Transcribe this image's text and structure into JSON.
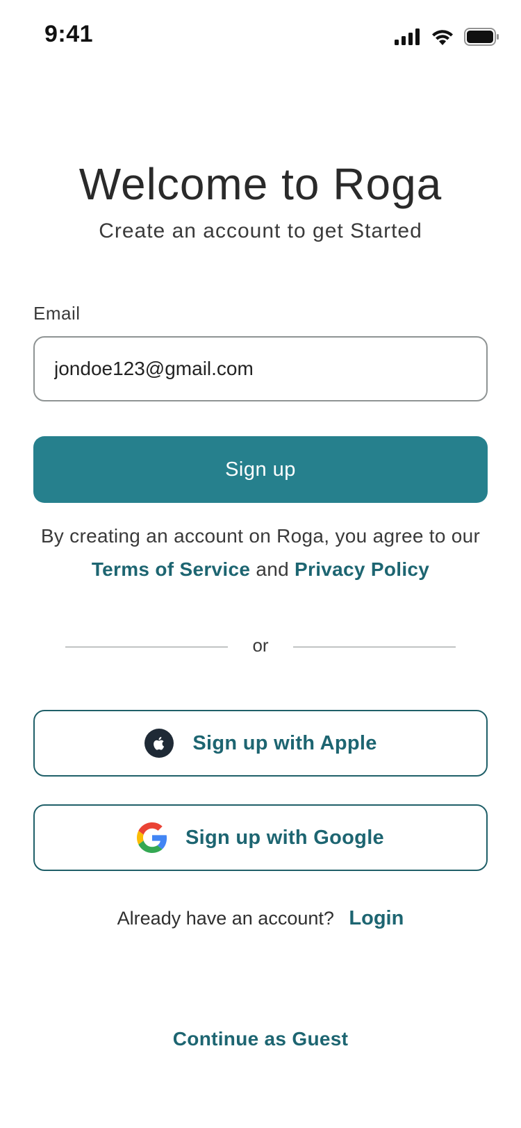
{
  "status_bar": {
    "time": "9:41"
  },
  "header": {
    "title": "Welcome to Roga",
    "subtitle": "Create an account to get Started"
  },
  "form": {
    "email_label": "Email",
    "email_value": "jondoe123@gmail.com",
    "signup_label": "Sign up"
  },
  "terms": {
    "prefix": "By creating an account on Roga, you agree to our",
    "terms_link": "Terms of Service",
    "conjunction": "and",
    "privacy_link": "Privacy Policy"
  },
  "divider": {
    "text": "or"
  },
  "social": {
    "apple_label": "Sign up with Apple",
    "google_label": "Sign up with Google"
  },
  "login": {
    "prompt": "Already have an account?",
    "link": "Login"
  },
  "guest": {
    "link": "Continue as Guest"
  },
  "colors": {
    "primary": "#26808d",
    "link": "#1d6571"
  },
  "icons": {
    "signal": "cellular-signal-icon",
    "wifi": "wifi-icon",
    "battery": "battery-icon",
    "apple": "apple-icon",
    "google": "google-icon"
  }
}
